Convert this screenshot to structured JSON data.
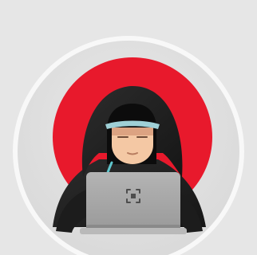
{
  "illustration": {
    "subject": "hooded-hacker-with-laptop-icon",
    "colors": {
      "page_background": "#e6e6e6",
      "badge_face": "#e1e1e1",
      "badge_ring": "#f7f7f7",
      "sun_red": "#e8192c",
      "hood_dark": "#232323",
      "hood_shadow": "#0c0c0c",
      "face_skin": "#f4c8a4",
      "face_shade": "#dca382",
      "eye_band": "#9fd0d6",
      "laptop_silver": "#a8a8a8",
      "laptop_edge": "#8a8a8a",
      "zipper_cyan": "#5fc6cc"
    }
  }
}
